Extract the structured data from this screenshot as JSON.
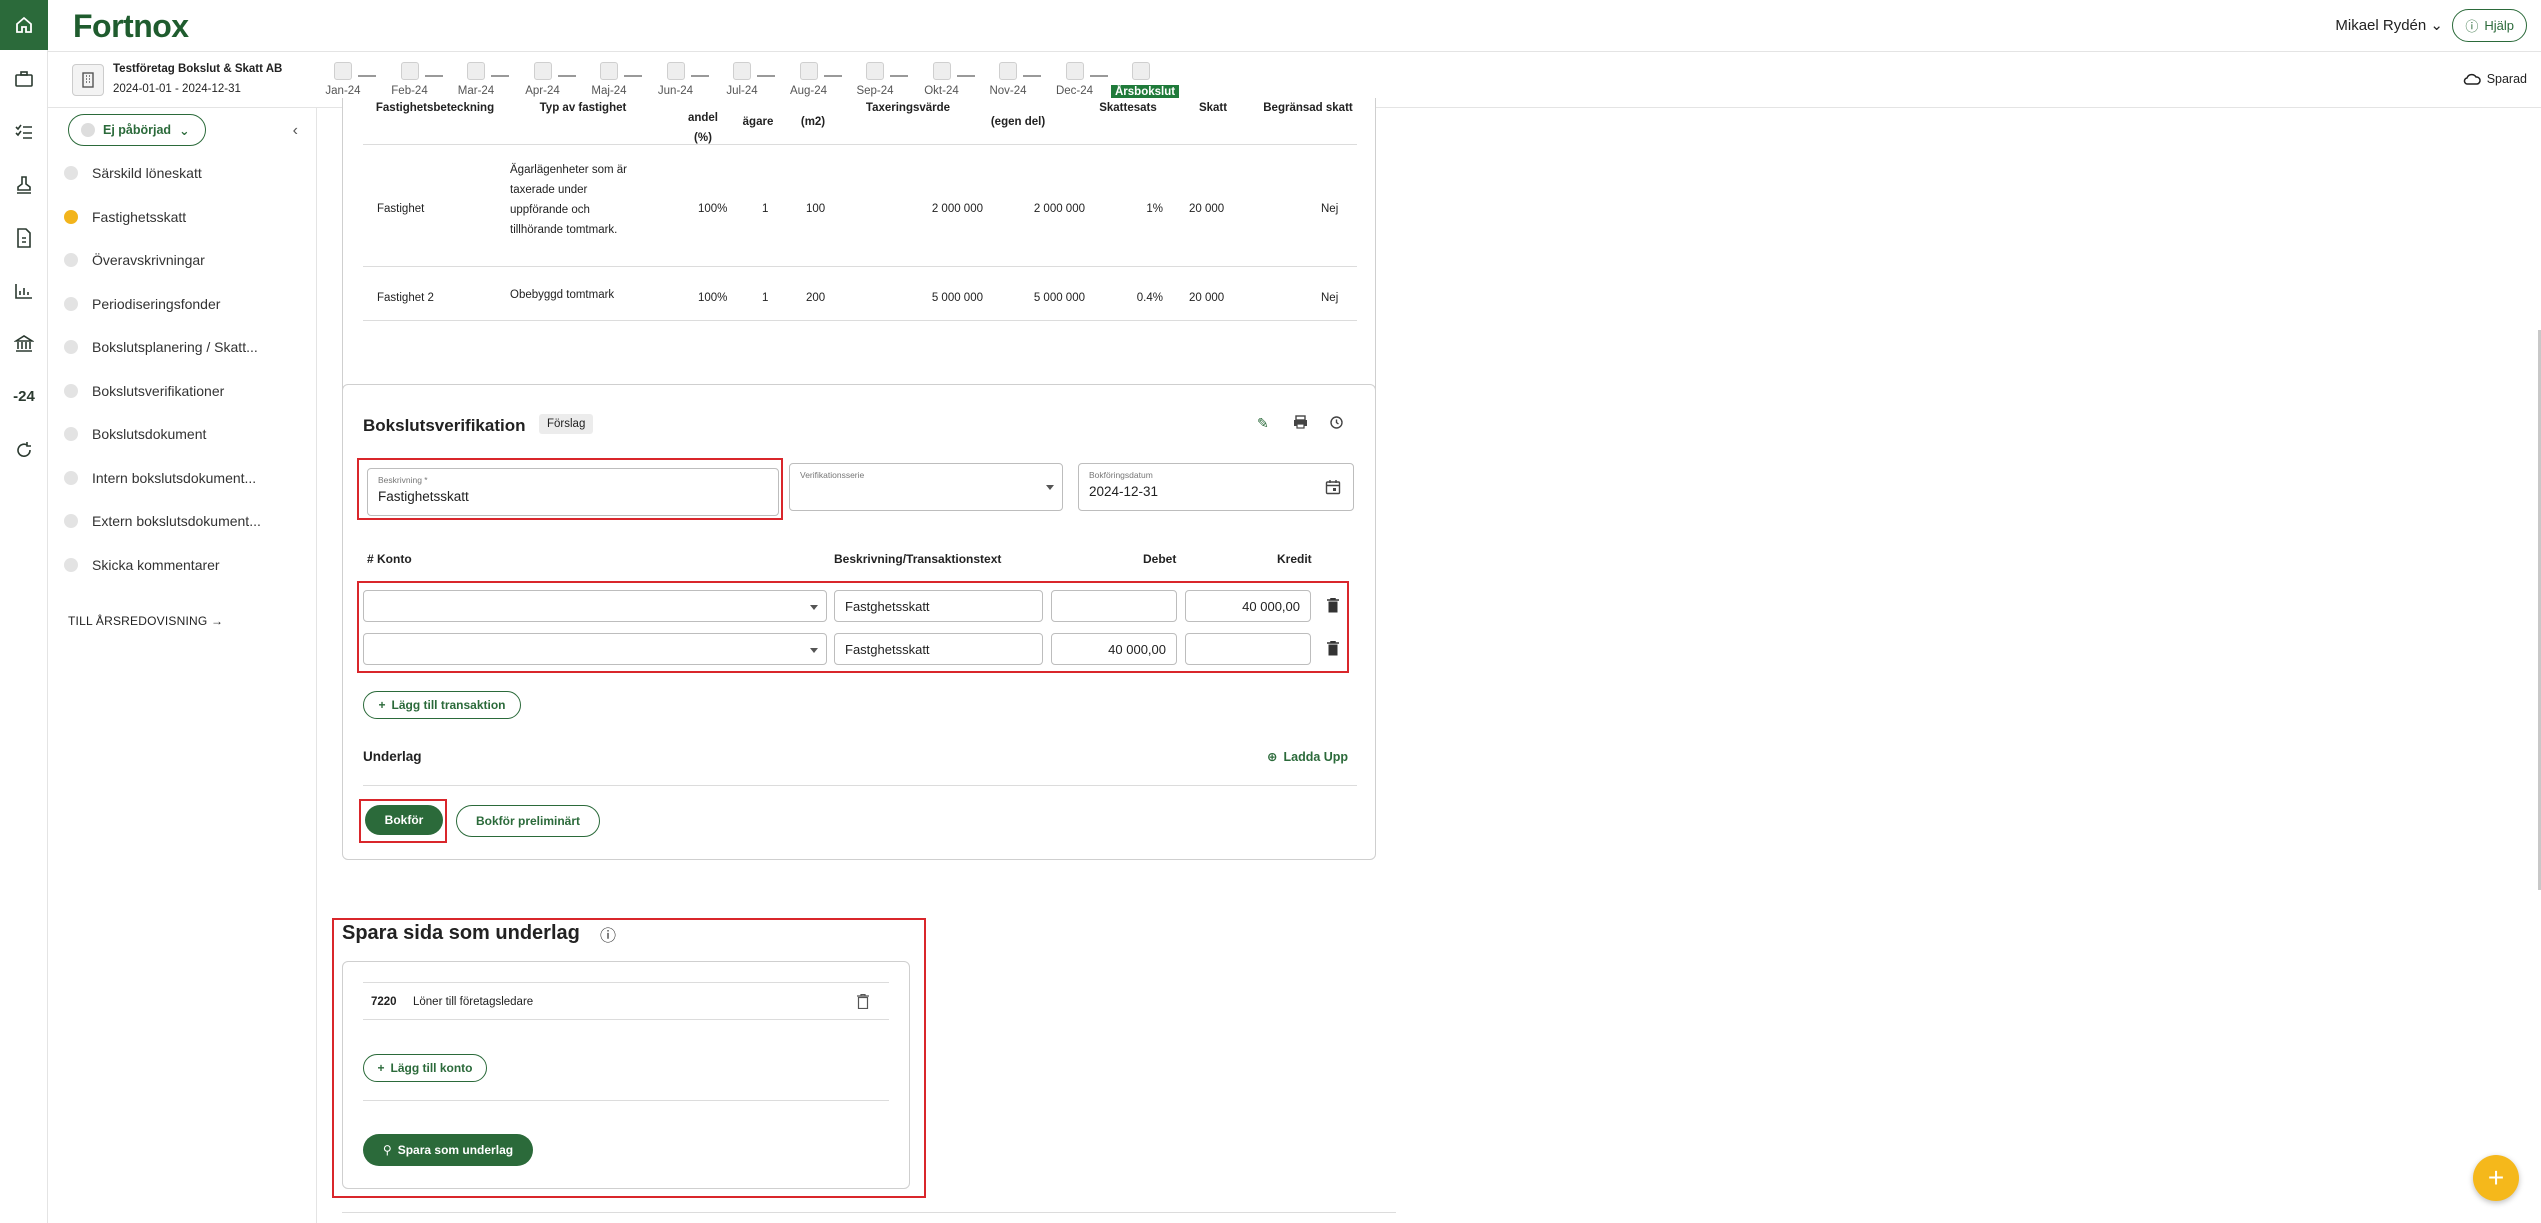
{
  "app": {
    "logo": "Fortnox",
    "user": "Mikael Rydén",
    "help": "Hjälp",
    "saved": "Sparad"
  },
  "company": {
    "name": "Testföretag Bokslut & Skatt AB",
    "period": "2024-01-01 - 2024-12-31"
  },
  "months": [
    "Jan-24",
    "Feb-24",
    "Mar-24",
    "Apr-24",
    "Maj-24",
    "Jun-24",
    "Jul-24",
    "Aug-24",
    "Sep-24",
    "Okt-24",
    "Nov-24",
    "Dec-24",
    "Årsbokslut"
  ],
  "rail": {
    "year_badge": "-24"
  },
  "nav": {
    "status": "Ej påbörjad",
    "items": [
      "Särskild löneskatt",
      "Fastighetsskatt",
      "Överavskrivningar",
      "Periodiseringsfonder",
      "Bokslutsplanering / Skatt...",
      "Bokslutsverifikationer",
      "Bokslutsdokument",
      "Intern bokslutsdokument...",
      "Extern bokslutsdokument...",
      "Skicka kommentarer"
    ],
    "active_index": 1,
    "to_report": "TILL ÅRSREDOVISNING"
  },
  "property_table": {
    "headers": [
      "Fastighetsbeteckning",
      "Typ av fastighet",
      "andel (%)",
      "ägare",
      "(m2)",
      "Taxeringsvärde",
      "(egen del)",
      "Skattesats",
      "Skatt",
      "Begränsad skatt"
    ],
    "rows": [
      {
        "name": "Fastighet",
        "type": "Ägarlägenheter som är taxerade under uppförande och tillhörande tomtmark.",
        "share": "100%",
        "owners": "1",
        "area": "100",
        "value": "2 000 000",
        "own": "2 000 000",
        "rate": "1%",
        "tax": "20 000",
        "limited": "Nej"
      },
      {
        "name": "Fastighet 2",
        "type": "Obebyggd tomtmark",
        "share": "100%",
        "owners": "1",
        "area": "200",
        "value": "5 000 000",
        "own": "5 000 000",
        "rate": "0.4%",
        "tax": "20 000",
        "limited": "Nej"
      }
    ]
  },
  "verification": {
    "title": "Bokslutsverifikation",
    "badge": "Förslag",
    "description_label": "Beskrivning *",
    "description_value": "Fastighetsskatt",
    "series_label": "Verifikationsserie",
    "date_label": "Bokföringsdatum",
    "date_value": "2024-12-31",
    "col_konto": "# Konto",
    "col_text": "Beskrivning/Transaktionstext",
    "col_debet": "Debet",
    "col_kredit": "Kredit",
    "rows": [
      {
        "text": "Fastghetsskatt",
        "debet": "",
        "kredit": "40 000,00"
      },
      {
        "text": "Fastghetsskatt",
        "debet": "40 000,00",
        "kredit": ""
      }
    ],
    "add_transaction": "Lägg till transaktion",
    "underlag": "Underlag",
    "upload": "Ladda Upp",
    "book": "Bokför",
    "book_prelim": "Bokför preliminärt"
  },
  "save_page": {
    "title": "Spara sida som underlag",
    "account_no": "7220",
    "account_name": "Löner till företagsledare",
    "add_account": "Lägg till konto",
    "save_btn": "Spara som underlag"
  },
  "colors": {
    "brand": "#2b6a3a",
    "highlight": "#d9262b",
    "fab": "#f5b81b"
  }
}
